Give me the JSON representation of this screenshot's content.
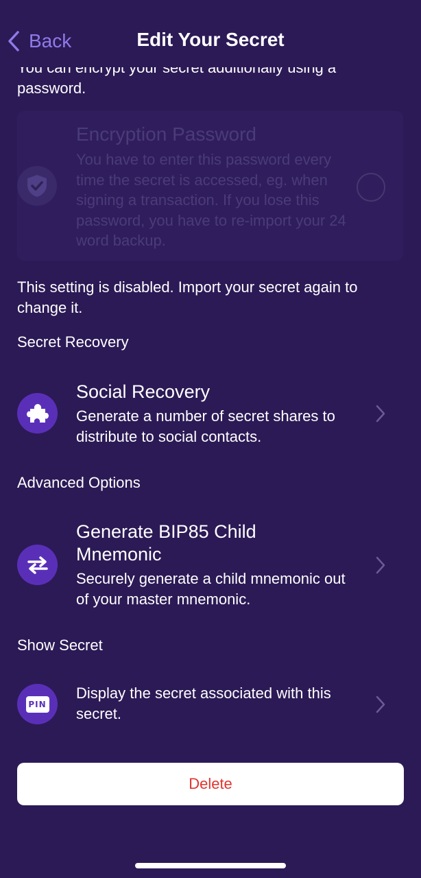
{
  "colors": {
    "background": "#2c1a56",
    "accent": "#8f7ae8",
    "icon_bg": "#5a2fb8",
    "danger": "#e0342f"
  },
  "header": {
    "back_label": "Back",
    "title": "Edit Your Secret"
  },
  "encryption": {
    "intro": "You can encrypt your secret additionally using a password.",
    "title": "Encryption Password",
    "description": "You have to enter this password every time the secret is accessed, eg. when signing a transaction. If you lose this password, you have to re-import your 24 word backup.",
    "icon": "shield-check-icon",
    "selected": false,
    "disabled_note": "This setting is disabled. Import your secret again to change it."
  },
  "secret_recovery": {
    "section_title": "Secret Recovery",
    "social": {
      "icon": "puzzle-icon",
      "title": "Social Recovery",
      "description": "Generate a number of secret shares to distribute to social contacts."
    }
  },
  "advanced": {
    "section_title": "Advanced Options",
    "bip85": {
      "icon": "swap-arrows-icon",
      "title": "Generate BIP85 Child Mnemonic",
      "description": "Securely generate a child mnemonic out of your master mnemonic."
    }
  },
  "show_secret": {
    "section_title": "Show Secret",
    "display": {
      "icon": "pin-icon",
      "icon_text": "PIN",
      "description": "Display the secret associated with this secret."
    }
  },
  "delete_label": "Delete"
}
